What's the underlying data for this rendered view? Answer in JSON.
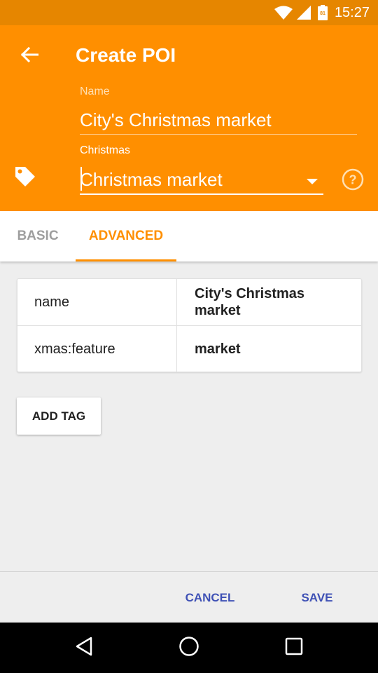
{
  "status_bar": {
    "time": "15:27",
    "battery_level": "81",
    "icons": [
      "wifi-icon",
      "signal-icon",
      "battery-icon"
    ]
  },
  "header": {
    "title": "Create POI",
    "back_icon": "arrow-left-icon",
    "name_label": "Name",
    "name_value": "City's Christmas market",
    "preset_label": "Christmas",
    "preset_value": "Christmas market",
    "tag_icon": "tag-icon",
    "help_icon": "help-circle-icon"
  },
  "tabs": [
    {
      "label": "BASIC",
      "active": false
    },
    {
      "label": "ADVANCED",
      "active": true
    }
  ],
  "tags_table": {
    "rows": [
      {
        "key": "name",
        "value": "City's Christmas market"
      },
      {
        "key": "xmas:feature",
        "value": "market"
      }
    ]
  },
  "buttons": {
    "add_tag": "ADD TAG",
    "cancel": "CANCEL",
    "save": "SAVE"
  },
  "colors": {
    "accent": "#ff8f00",
    "status_bar": "#e68600",
    "action_text": "#3f51b5"
  },
  "nav_bar": {
    "icons": [
      "back-triangle-icon",
      "home-circle-icon",
      "recents-square-icon"
    ]
  }
}
